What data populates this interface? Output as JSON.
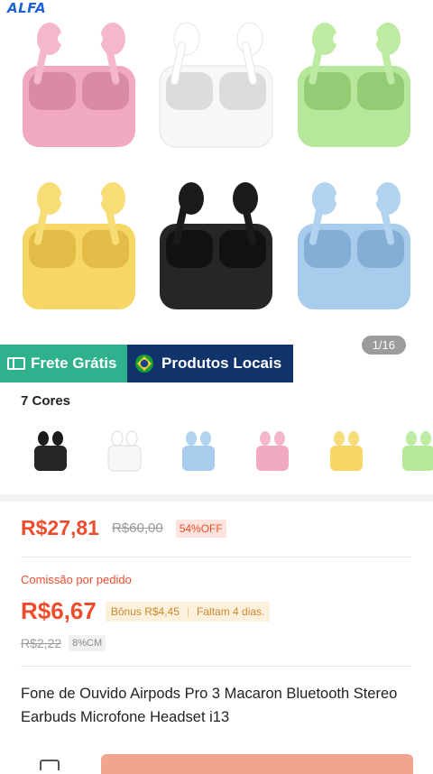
{
  "brand": {
    "logo_text": "ALFA"
  },
  "gallery": {
    "counter": "1/16",
    "images": [
      {
        "color": "pink",
        "icon": "earbuds-pink-image"
      },
      {
        "color": "white",
        "icon": "earbuds-white-image"
      },
      {
        "color": "green",
        "icon": "earbuds-green-image"
      },
      {
        "color": "yellow",
        "icon": "earbuds-yellow-image"
      },
      {
        "color": "black",
        "icon": "earbuds-black-image"
      },
      {
        "color": "blue",
        "icon": "earbuds-blue-image"
      }
    ]
  },
  "badges": {
    "free_shipping": "Frete Grátis",
    "local_products": "Produtos Locais"
  },
  "colors": {
    "title": "7 Cores",
    "swatches": [
      "black",
      "white",
      "blue",
      "pink",
      "yellow",
      "green"
    ]
  },
  "price": {
    "current": "R$27,81",
    "original": "R$60,00",
    "discount": "54%OFF"
  },
  "commission": {
    "label": "Comissão por pedido",
    "value": "R$6,67",
    "bonus": "Bônus R$4,45",
    "remaining": "Faltam 4 dias.",
    "old_value": "R$2,22",
    "rate_tag": "8%CM"
  },
  "product": {
    "title": "Fone de Ouvido Airpods Pro 3 Macaron Bluetooth Stereo Earbuds Microfone Headset i13"
  },
  "palette": {
    "pink": "#f1a9c0",
    "white": "#f7f7f7",
    "green": "#b6e79a",
    "yellow": "#f6d665",
    "black": "#262626",
    "blue": "#a8ccec",
    "accent": "#ee4d2d",
    "frete": "#2fb18d",
    "local": "#10336b"
  }
}
